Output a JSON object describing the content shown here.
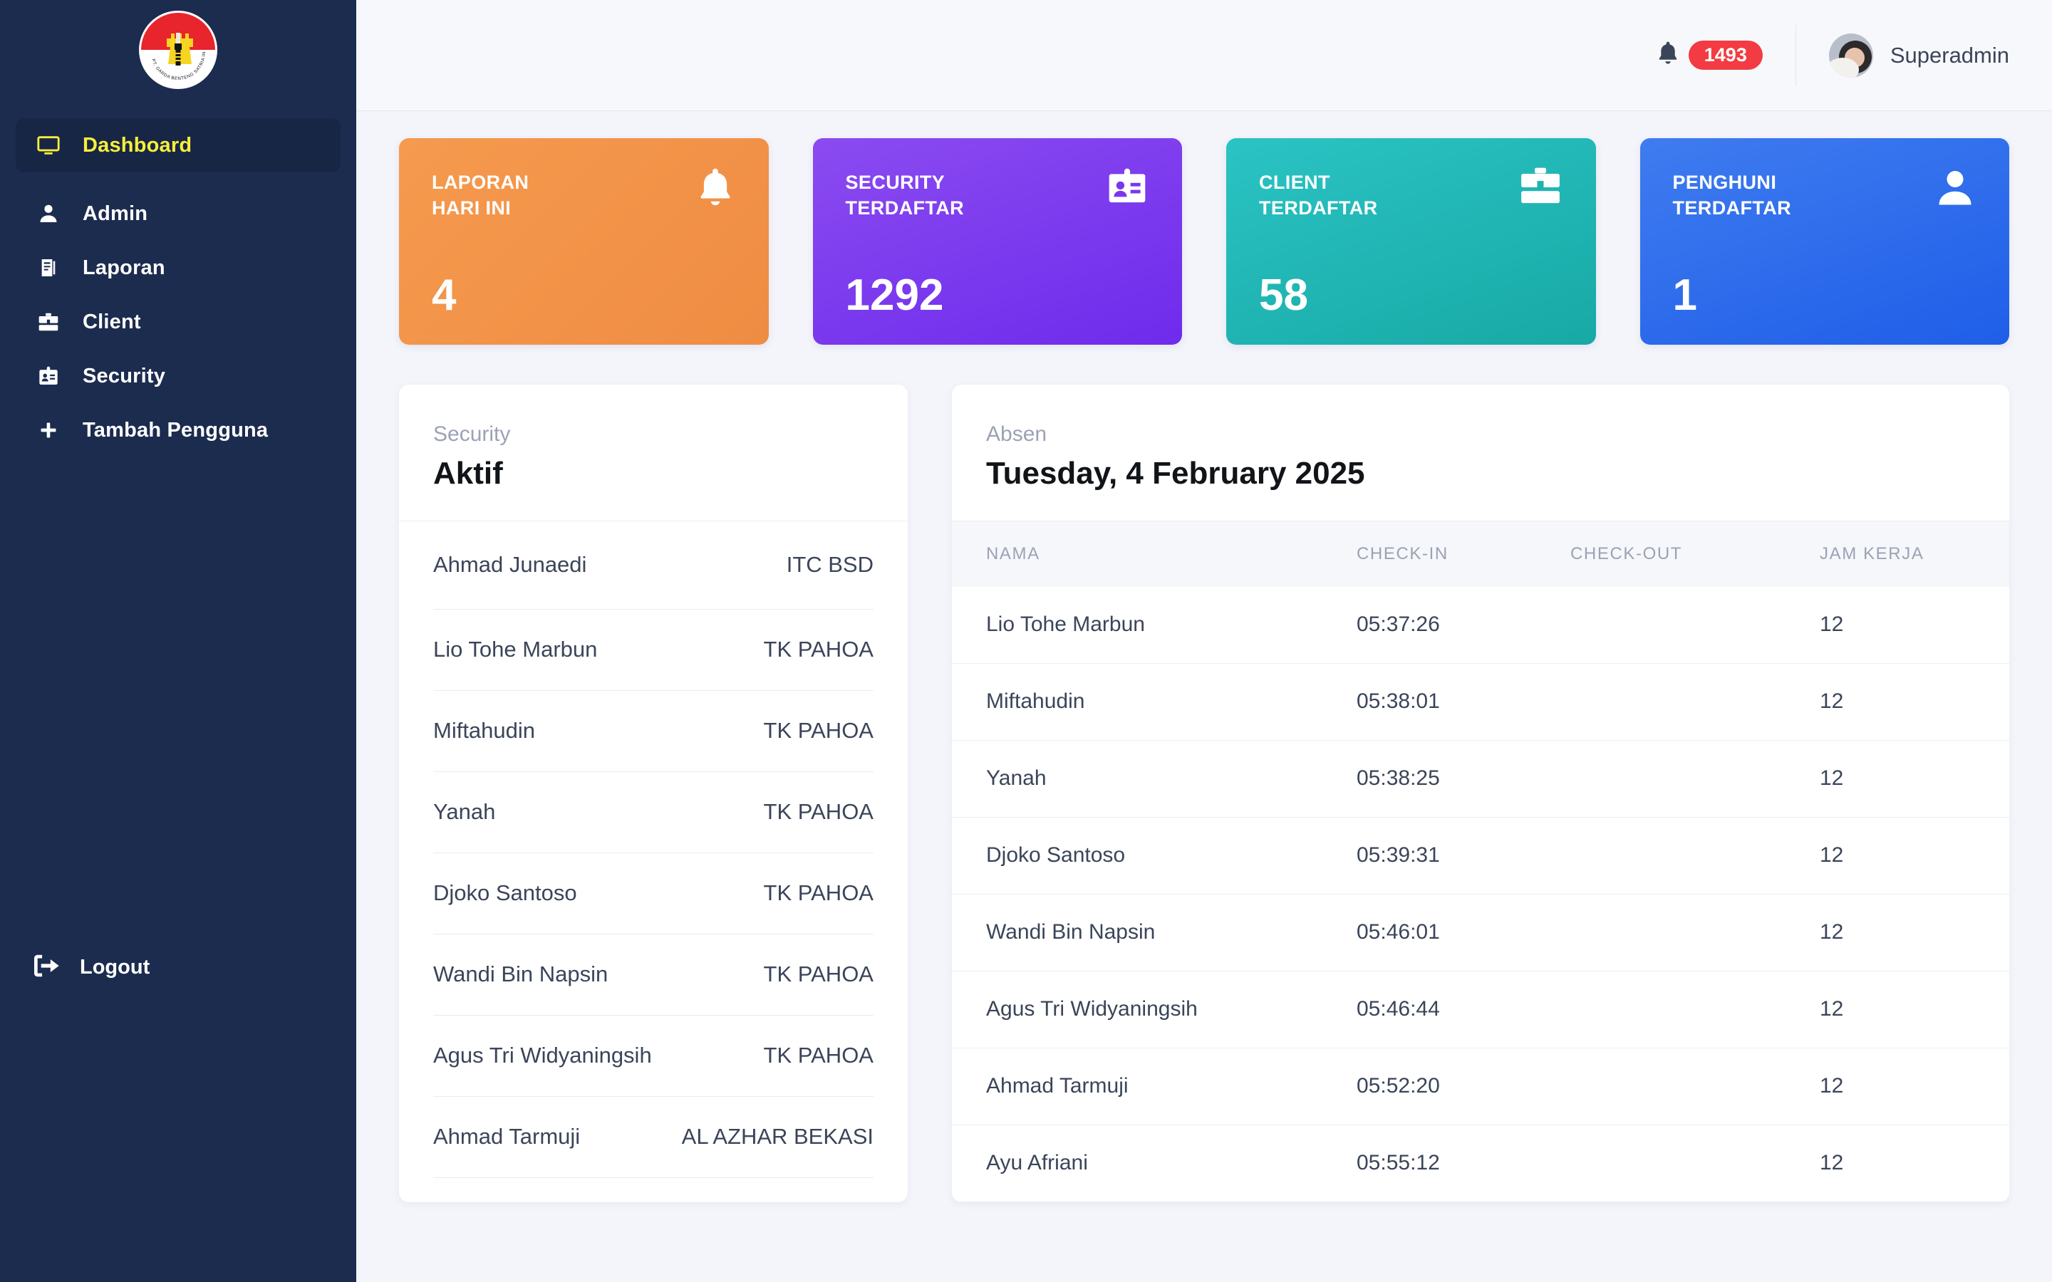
{
  "sidebar": {
    "logo_text": "PT. GARDA BENTENG SATRIA INDONESIA",
    "items": [
      {
        "label": "Dashboard",
        "icon": "monitor-icon",
        "active": true
      },
      {
        "label": "Admin",
        "icon": "user-icon",
        "active": false
      },
      {
        "label": "Laporan",
        "icon": "document-icon",
        "active": false
      },
      {
        "label": "Client",
        "icon": "briefcase-icon",
        "active": false
      },
      {
        "label": "Security",
        "icon": "id-card-icon",
        "active": false
      },
      {
        "label": "Tambah Pengguna",
        "icon": "plus-icon",
        "active": false
      }
    ],
    "logout_label": "Logout"
  },
  "topbar": {
    "notification_count": "1493",
    "user_name": "Superadmin"
  },
  "cards": [
    {
      "title_line1": "LAPORAN",
      "title_line2": "HARI INI",
      "value": "4",
      "icon": "bell-icon",
      "color": "#ef8c43"
    },
    {
      "title_line1": "SECURITY",
      "title_line2": "TERDAFTAR",
      "value": "1292",
      "icon": "id-card-icon",
      "color": "#7b36ee"
    },
    {
      "title_line1": "CLIENT",
      "title_line2": "TERDAFTAR",
      "value": "58",
      "icon": "briefcase-icon",
      "color": "#1fb3b0"
    },
    {
      "title_line1": "PENGHUNI",
      "title_line2": "TERDAFTAR",
      "value": "1",
      "icon": "person-icon",
      "color": "#2a68ea"
    }
  ],
  "security_panel": {
    "subtitle": "Security",
    "title": "Aktif",
    "rows": [
      {
        "name": "Ahmad Junaedi",
        "location": "ITC BSD"
      },
      {
        "name": "Lio Tohe Marbun",
        "location": "TK PAHOA"
      },
      {
        "name": "Miftahudin",
        "location": "TK PAHOA"
      },
      {
        "name": "Yanah",
        "location": "TK PAHOA"
      },
      {
        "name": "Djoko Santoso",
        "location": "TK PAHOA"
      },
      {
        "name": "Wandi Bin Napsin",
        "location": "TK PAHOA"
      },
      {
        "name": "Agus Tri Widyaningsih",
        "location": "TK PAHOA"
      },
      {
        "name": "Ahmad Tarmuji",
        "location": "AL AZHAR BEKASI"
      }
    ]
  },
  "absen_panel": {
    "subtitle": "Absen",
    "title": "Tuesday, 4 February 2025",
    "columns": [
      "NAMA",
      "CHECK-IN",
      "CHECK-OUT",
      "JAM KERJA"
    ],
    "rows": [
      {
        "nama": "Lio Tohe Marbun",
        "check_in": "05:37:26",
        "check_out": "",
        "jam_kerja": "12"
      },
      {
        "nama": "Miftahudin",
        "check_in": "05:38:01",
        "check_out": "",
        "jam_kerja": "12"
      },
      {
        "nama": "Yanah",
        "check_in": "05:38:25",
        "check_out": "",
        "jam_kerja": "12"
      },
      {
        "nama": "Djoko Santoso",
        "check_in": "05:39:31",
        "check_out": "",
        "jam_kerja": "12"
      },
      {
        "nama": "Wandi Bin Napsin",
        "check_in": "05:46:01",
        "check_out": "",
        "jam_kerja": "12"
      },
      {
        "nama": "Agus Tri Widyaningsih",
        "check_in": "05:46:44",
        "check_out": "",
        "jam_kerja": "12"
      },
      {
        "nama": "Ahmad Tarmuji",
        "check_in": "05:52:20",
        "check_out": "",
        "jam_kerja": "12"
      },
      {
        "nama": "Ayu Afriani",
        "check_in": "05:55:12",
        "check_out": "",
        "jam_kerja": "12"
      }
    ]
  }
}
